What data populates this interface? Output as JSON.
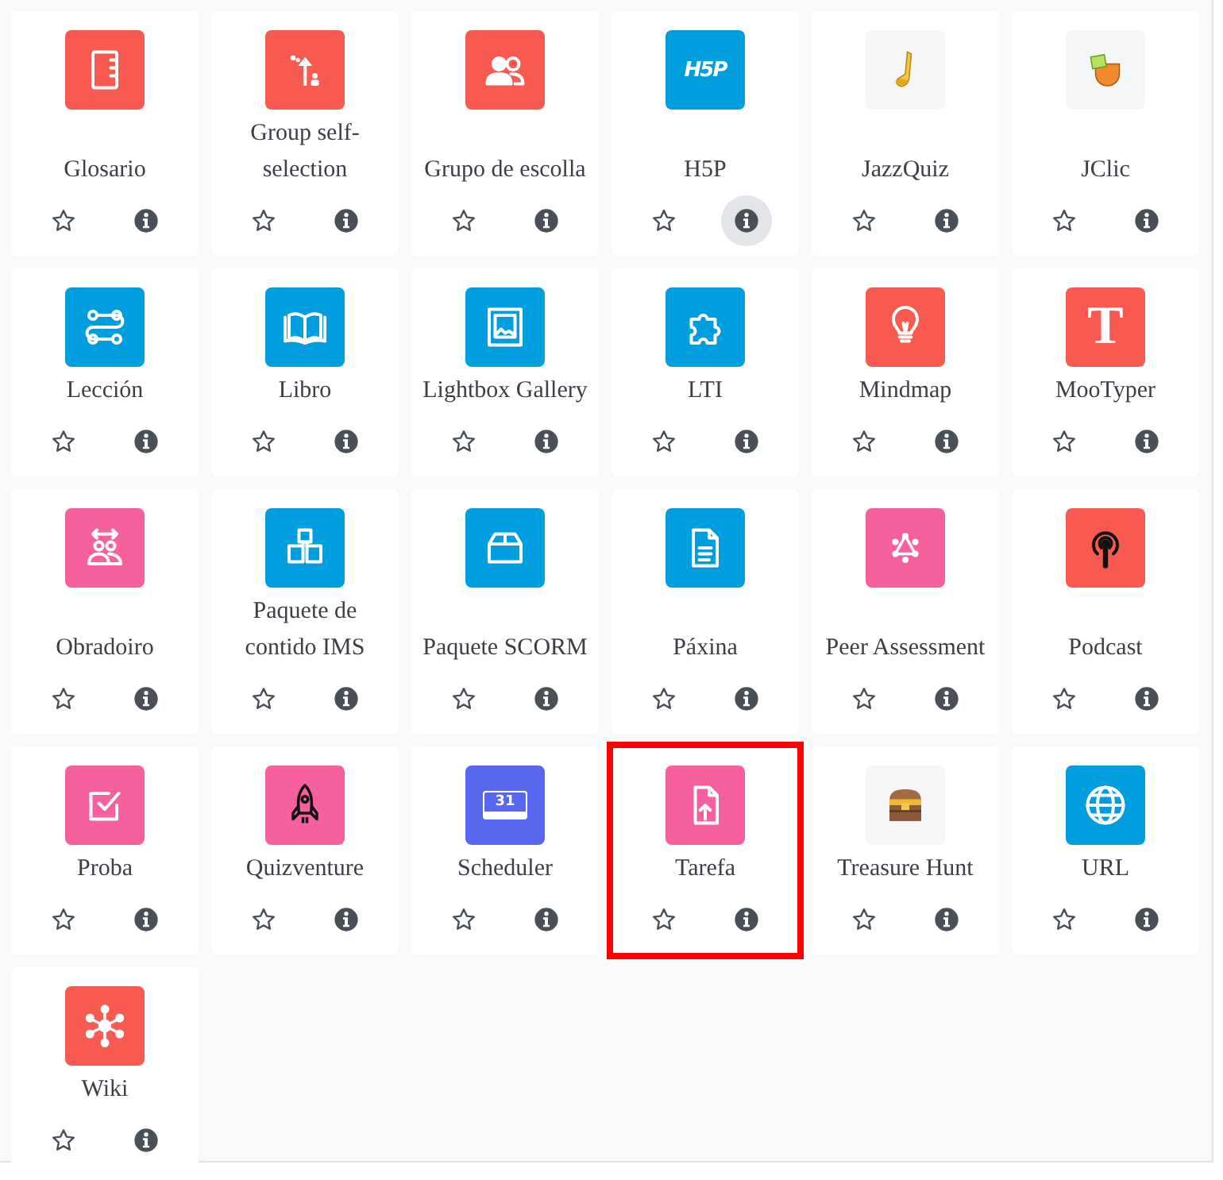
{
  "activities": [
    {
      "label": "Glosario",
      "color": "#f85a52",
      "info_active": false,
      "highlighted": false
    },
    {
      "label": "Group self-selection",
      "color": "#f85a52",
      "info_active": false,
      "highlighted": false
    },
    {
      "label": "Grupo de escolla",
      "color": "#f85a52",
      "info_active": false,
      "highlighted": false
    },
    {
      "label": "H5P",
      "color": "#009ddf",
      "icon_text": "H5P",
      "info_active": true,
      "highlighted": false
    },
    {
      "label": "JazzQuiz",
      "color": "#f5f6f8",
      "info_active": false,
      "highlighted": false
    },
    {
      "label": "JClic",
      "color": "#f5f6f8",
      "info_active": false,
      "highlighted": false
    },
    {
      "label": "Lección",
      "color": "#009ddf",
      "info_active": false,
      "highlighted": false
    },
    {
      "label": "Libro",
      "color": "#009ddf",
      "info_active": false,
      "highlighted": false
    },
    {
      "label": "Lightbox Gallery",
      "color": "#009ddf",
      "info_active": false,
      "highlighted": false
    },
    {
      "label": "LTI",
      "color": "#009ddf",
      "info_active": false,
      "highlighted": false
    },
    {
      "label": "Mindmap",
      "color": "#f85a52",
      "info_active": false,
      "highlighted": false
    },
    {
      "label": "MooTyper",
      "color": "#f85a52",
      "icon_text": "T",
      "info_active": false,
      "highlighted": false
    },
    {
      "label": "Obradoiro",
      "color": "#f7609e",
      "info_active": false,
      "highlighted": false
    },
    {
      "label": "Paquete de contido IMS",
      "color": "#009ddf",
      "info_active": false,
      "highlighted": false
    },
    {
      "label": "Paquete SCORM",
      "color": "#009ddf",
      "info_active": false,
      "highlighted": false
    },
    {
      "label": "Páxina",
      "color": "#009ddf",
      "info_active": false,
      "highlighted": false
    },
    {
      "label": "Peer Assessment",
      "color": "#f7609e",
      "info_active": false,
      "highlighted": false
    },
    {
      "label": "Podcast",
      "color": "#f85a52",
      "info_active": false,
      "highlighted": false
    },
    {
      "label": "Proba",
      "color": "#f7609e",
      "info_active": false,
      "highlighted": false
    },
    {
      "label": "Quizventure",
      "color": "#f7609e",
      "info_active": false,
      "highlighted": false
    },
    {
      "label": "Scheduler",
      "color": "#5867ef",
      "icon_text": "31",
      "info_active": false,
      "highlighted": false
    },
    {
      "label": "Tarefa",
      "color": "#f7609e",
      "info_active": false,
      "highlighted": true
    },
    {
      "label": "Treasure Hunt",
      "color": "#f5f6f8",
      "info_active": false,
      "highlighted": false
    },
    {
      "label": "URL",
      "color": "#009ddf",
      "info_active": false,
      "highlighted": false
    },
    {
      "label": "Wiki",
      "color": "#f85a52",
      "info_active": false,
      "highlighted": false
    }
  ]
}
